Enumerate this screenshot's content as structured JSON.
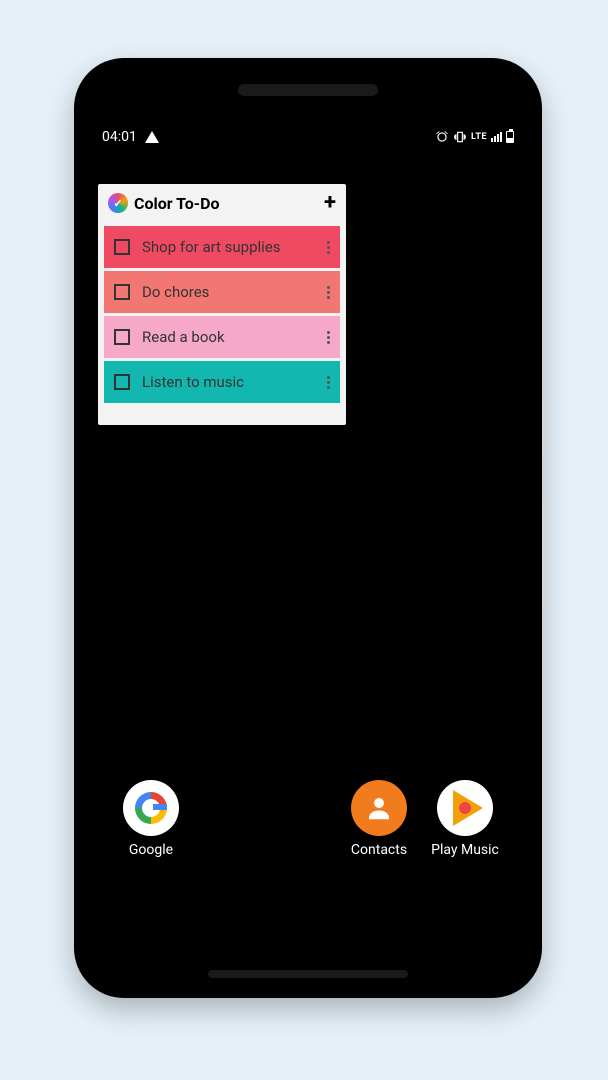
{
  "status": {
    "time": "04:01",
    "network": "LTE"
  },
  "widget": {
    "title": "Color To-Do",
    "items": [
      {
        "label": "Shop for art supplies",
        "color": "#f04a63"
      },
      {
        "label": "Do chores",
        "color": "#f27773"
      },
      {
        "label": "Read a book",
        "color": "#f5a8c8"
      },
      {
        "label": "Listen to music",
        "color": "#12b8b0"
      }
    ]
  },
  "apps": {
    "google": "Google",
    "contacts": "Contacts",
    "playmusic": "Play Music"
  }
}
